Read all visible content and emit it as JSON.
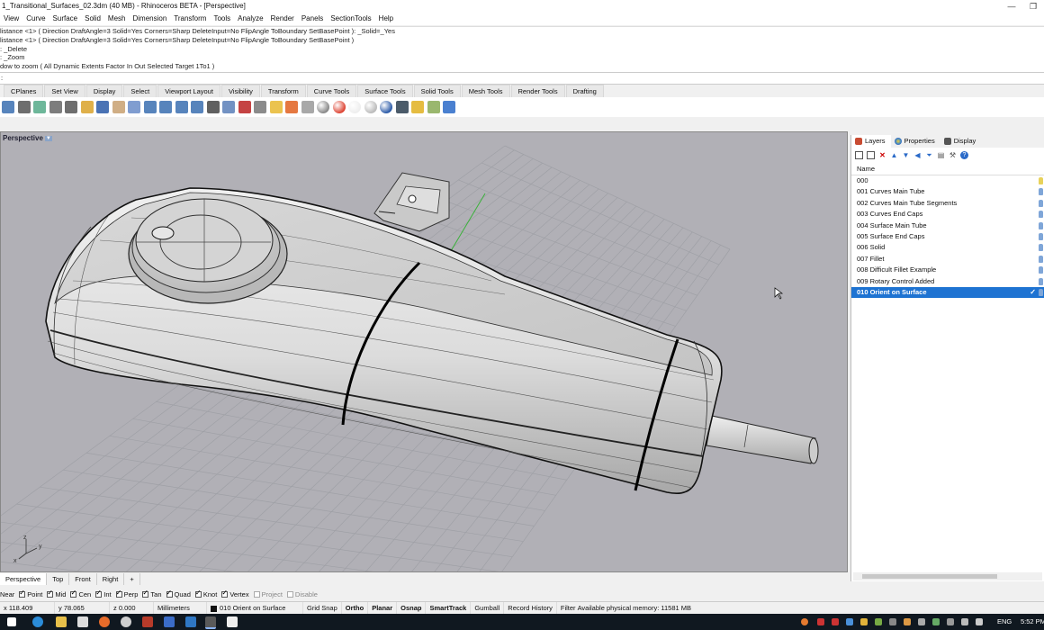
{
  "window": {
    "title": "1_Transitional_Surfaces_02.3dm (40 MB) - Rhinoceros BETA - [Perspective]",
    "controls": [
      "—",
      "❐"
    ]
  },
  "menu": [
    "View",
    "Curve",
    "Surface",
    "Solid",
    "Mesh",
    "Dimension",
    "Transform",
    "Tools",
    "Analyze",
    "Render",
    "Panels",
    "SectionTools",
    "Help"
  ],
  "command_history": [
    "listance <1> ( Direction  DraftAngle=3  Solid=Yes  Corners=Sharp  DeleteInput=No  FlipAngle  ToBoundary  SetBasePoint ): _Solid=_Yes",
    "listance <1> ( Direction  DraftAngle=3  Solid=Yes  Corners=Sharp  DeleteInput=No  FlipAngle  ToBoundary  SetBasePoint )",
    ": _Delete",
    ": _Zoom",
    "dow to zoom ( All  Dynamic  Extents  Factor  In  Out  Selected  Target  1To1 )"
  ],
  "command_prompt": ":",
  "toolbar_tabs": [
    "CPlanes",
    "Set View",
    "Display",
    "Select",
    "Viewport Layout",
    "Visibility",
    "Transform",
    "Curve Tools",
    "Surface Tools",
    "Solid Tools",
    "Mesh Tools",
    "Render Tools",
    "Drafting"
  ],
  "toolbar_icons": [
    "save-icon",
    "print-icon",
    "import-icon",
    "cut-icon",
    "copy-icon",
    "paste-icon",
    "undo-icon",
    "pan-hand-icon",
    "move-view-icon",
    "zoom-window-icon",
    "zoom-dynamic-icon",
    "zoom-extents-icon",
    "zoom-selected-icon",
    "rotate-view-icon",
    "four-viewports-icon",
    "cplane-icon",
    "named-view-icon",
    "layer-icon",
    "properties-icon",
    "light-icon",
    "lock-icon",
    "material-icon",
    "wireframe-icon",
    "shaded-icon",
    "rendered-icon",
    "render-icon",
    "dimension-icon",
    "options-icon",
    "help-icon"
  ],
  "viewport": {
    "title": "Perspective",
    "axes": {
      "x": "x",
      "y": "y",
      "z": "z"
    }
  },
  "panel": {
    "tabs": [
      "Layers",
      "Properties",
      "Display"
    ],
    "column_header": "Name",
    "layers": [
      {
        "name": "000",
        "selected": false
      },
      {
        "name": "001 Curves Main Tube",
        "selected": false
      },
      {
        "name": "002 Curves Main Tube Segments",
        "selected": false
      },
      {
        "name": "003 Curves End Caps",
        "selected": false
      },
      {
        "name": "004 Surface Main Tube",
        "selected": false
      },
      {
        "name": "005 Surface End Caps",
        "selected": false
      },
      {
        "name": "006 Solid",
        "selected": false
      },
      {
        "name": "007 Fillet",
        "selected": false
      },
      {
        "name": "008 Difficult Fillet Example",
        "selected": false
      },
      {
        "name": "009 Rotary Control Added",
        "selected": false
      },
      {
        "name": "010 Orient on Surface",
        "selected": true
      }
    ]
  },
  "viewport_tabs": [
    "Perspective",
    "Top",
    "Front",
    "Right",
    "+"
  ],
  "osnaps": [
    {
      "label": "Near",
      "on": false
    },
    {
      "label": "Point",
      "on": true
    },
    {
      "label": "Mid",
      "on": true
    },
    {
      "label": "Cen",
      "on": true
    },
    {
      "label": "Int",
      "on": true
    },
    {
      "label": "Perp",
      "on": true
    },
    {
      "label": "Tan",
      "on": true
    },
    {
      "label": "Quad",
      "on": true
    },
    {
      "label": "Knot",
      "on": true
    },
    {
      "label": "Vertex",
      "on": true
    },
    {
      "label": "Project",
      "on": false
    },
    {
      "label": "Disable",
      "on": false
    }
  ],
  "status": {
    "x": "x 118.409",
    "y": "y 78.065",
    "z": "z 0.000",
    "units": "Millimeters",
    "layer": "010 Orient on Surface",
    "grid_snap": "Grid Snap",
    "ortho": "Ortho",
    "planar": "Planar",
    "osnap": "Osnap",
    "smarttrack": "SmartTrack",
    "gumball": "Gumball",
    "record_history": "Record History",
    "filter": "Filter",
    "memory": "Available physical memory: 11581 MB"
  },
  "taskbar": {
    "language": "ENG",
    "time": "5:52 PM"
  }
}
